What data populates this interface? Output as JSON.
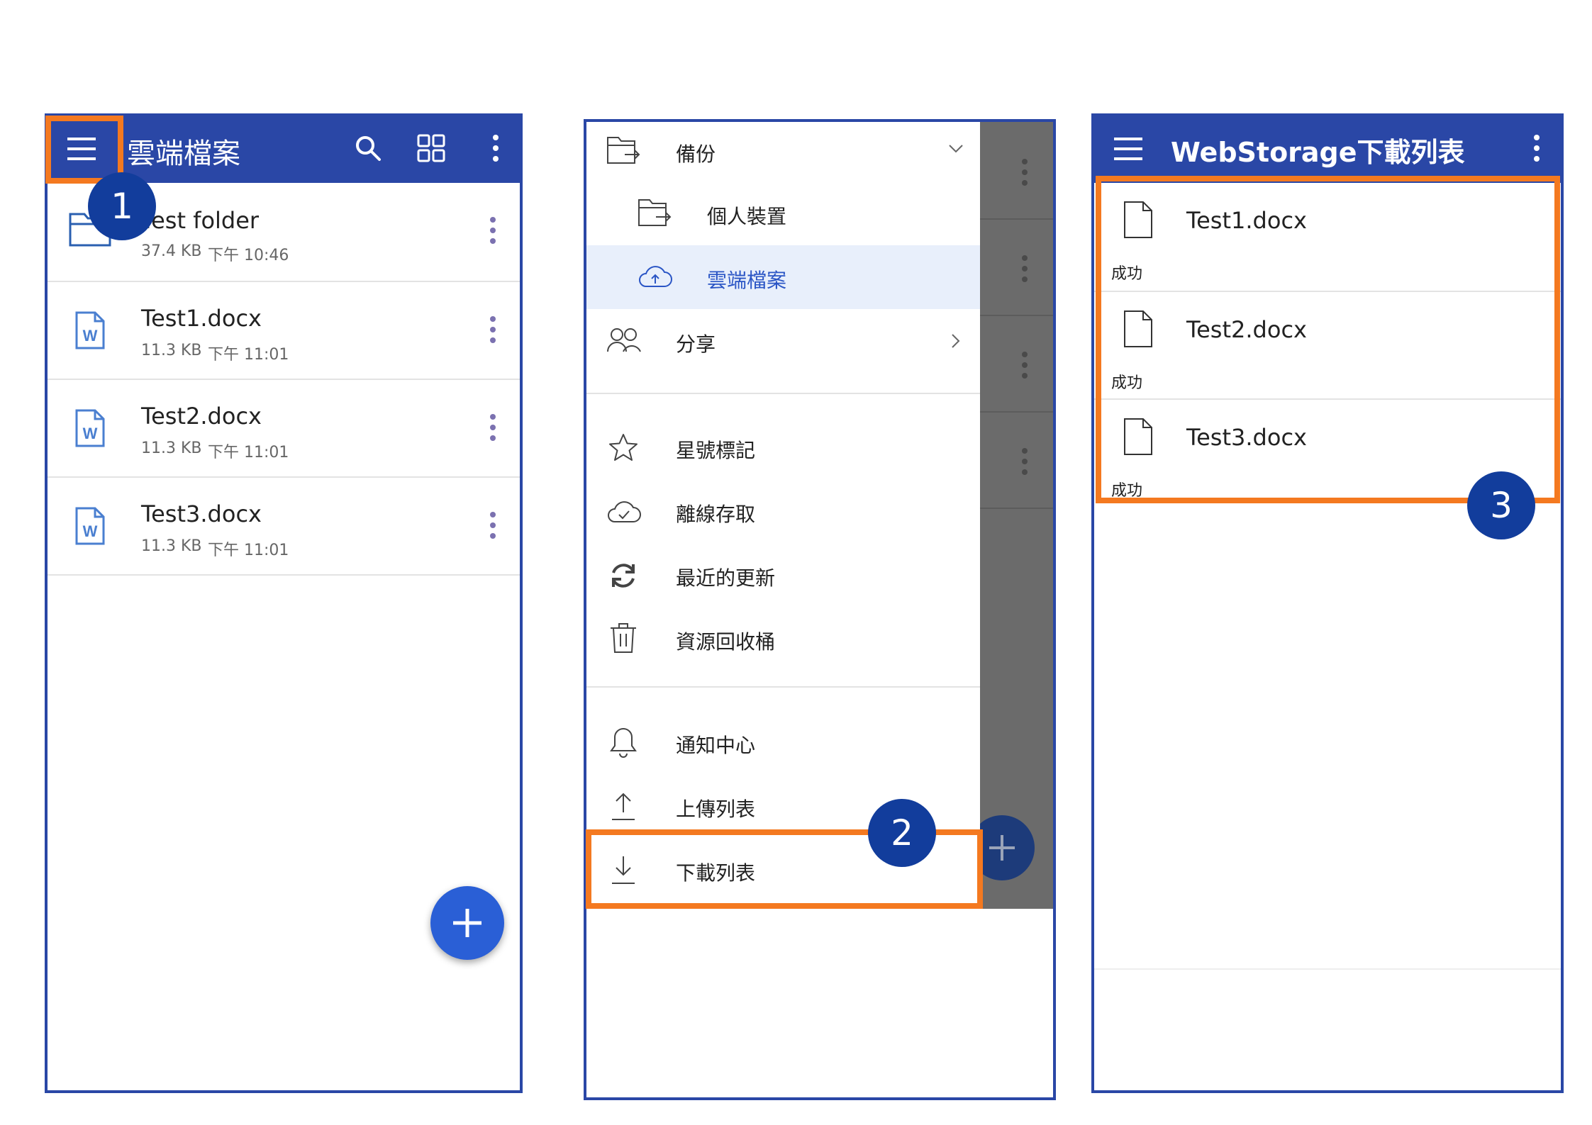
{
  "panel1": {
    "app_title": "雲端檔案",
    "files": [
      {
        "name": "Test folder",
        "size": "37.4 KB",
        "time": "下午 10:46",
        "kind": "folder"
      },
      {
        "name": "Test1.docx",
        "size": "11.3 KB",
        "time": "下午 11:01",
        "kind": "word"
      },
      {
        "name": "Test2.docx",
        "size": "11.3 KB",
        "time": "下午 11:01",
        "kind": "word"
      },
      {
        "name": "Test3.docx",
        "size": "11.3 KB",
        "time": "下午 11:01",
        "kind": "word"
      }
    ],
    "fab_label": "+",
    "step_badge": "1"
  },
  "panel2": {
    "menu": {
      "backup": "備份",
      "personal_device": "個人裝置",
      "cloud_files": "雲端檔案",
      "share": "分享",
      "starred": "星號標記",
      "offline": "離線存取",
      "recent": "最近的更新",
      "trash": "資源回收桶",
      "notifications": "通知中心",
      "upload_list": "上傳列表",
      "download_list": "下載列表"
    },
    "fab_label": "+",
    "step_badge": "2"
  },
  "panel3": {
    "app_title": "WebStorage下載列表",
    "downloads": [
      {
        "name": "Test1.docx",
        "status": "成功"
      },
      {
        "name": "Test2.docx",
        "status": "成功"
      },
      {
        "name": "Test3.docx",
        "status": "成功"
      }
    ],
    "step_badge": "3"
  },
  "colors": {
    "appbar": "#2a47a6",
    "highlight": "#f47920",
    "badge": "#123d9c",
    "fab": "#2a5fd6",
    "active_menu_bg": "#e8effb",
    "scrim": "#6b6b6b"
  },
  "icons": [
    "menu-icon",
    "search-icon",
    "grid-view-icon",
    "more-vert-icon",
    "folder-icon",
    "word-file-icon",
    "plus-icon",
    "backup-folder-icon",
    "cloud-icon",
    "people-icon",
    "star-icon",
    "cloud-check-icon",
    "sync-icon",
    "trash-icon",
    "bell-icon",
    "upload-icon",
    "download-icon",
    "file-icon",
    "chevron-down-icon",
    "chevron-right-icon"
  ]
}
